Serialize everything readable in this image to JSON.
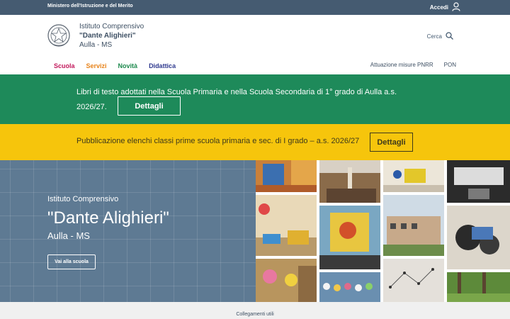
{
  "topbar": {
    "ministry": "Ministero dell'Istruzione e del Merito",
    "login": "Accedi"
  },
  "header": {
    "school_line1": "Istituto Comprensivo",
    "school_name": "\"Dante Alighieri\"",
    "school_location": "Aulla - MS",
    "search_label": "Cerca"
  },
  "nav": {
    "main": [
      "Scuola",
      "Servizi",
      "Novità",
      "Didattica"
    ],
    "secondary": [
      "Attuazione misure PNRR",
      "PON"
    ]
  },
  "alerts": [
    {
      "text": "Libri di testo adottati nella Scuola Primaria e nella Scuola Secondaria di 1° grado di Aulla a.s. 2026/27.",
      "button": "Dettagli",
      "color": "#1e8a5a"
    },
    {
      "text": "Pubblicazione elenchi classi prime scuola primaria e sec. di I grado – a.s. 2026/27",
      "button": "Dettagli",
      "color": "#f6c50c"
    }
  ],
  "hero": {
    "subtitle": "Istituto Comprensivo",
    "title": "\"Dante Alighieri\"",
    "location": "Aulla - MS",
    "button": "Vai alla scuola"
  },
  "footer": {
    "label": "Collegamenti utili"
  },
  "colors": {
    "topbar": "#455b71",
    "hero": "#5e7a93",
    "accent_green": "#1e8a5a",
    "accent_yellow": "#f6c50c"
  }
}
